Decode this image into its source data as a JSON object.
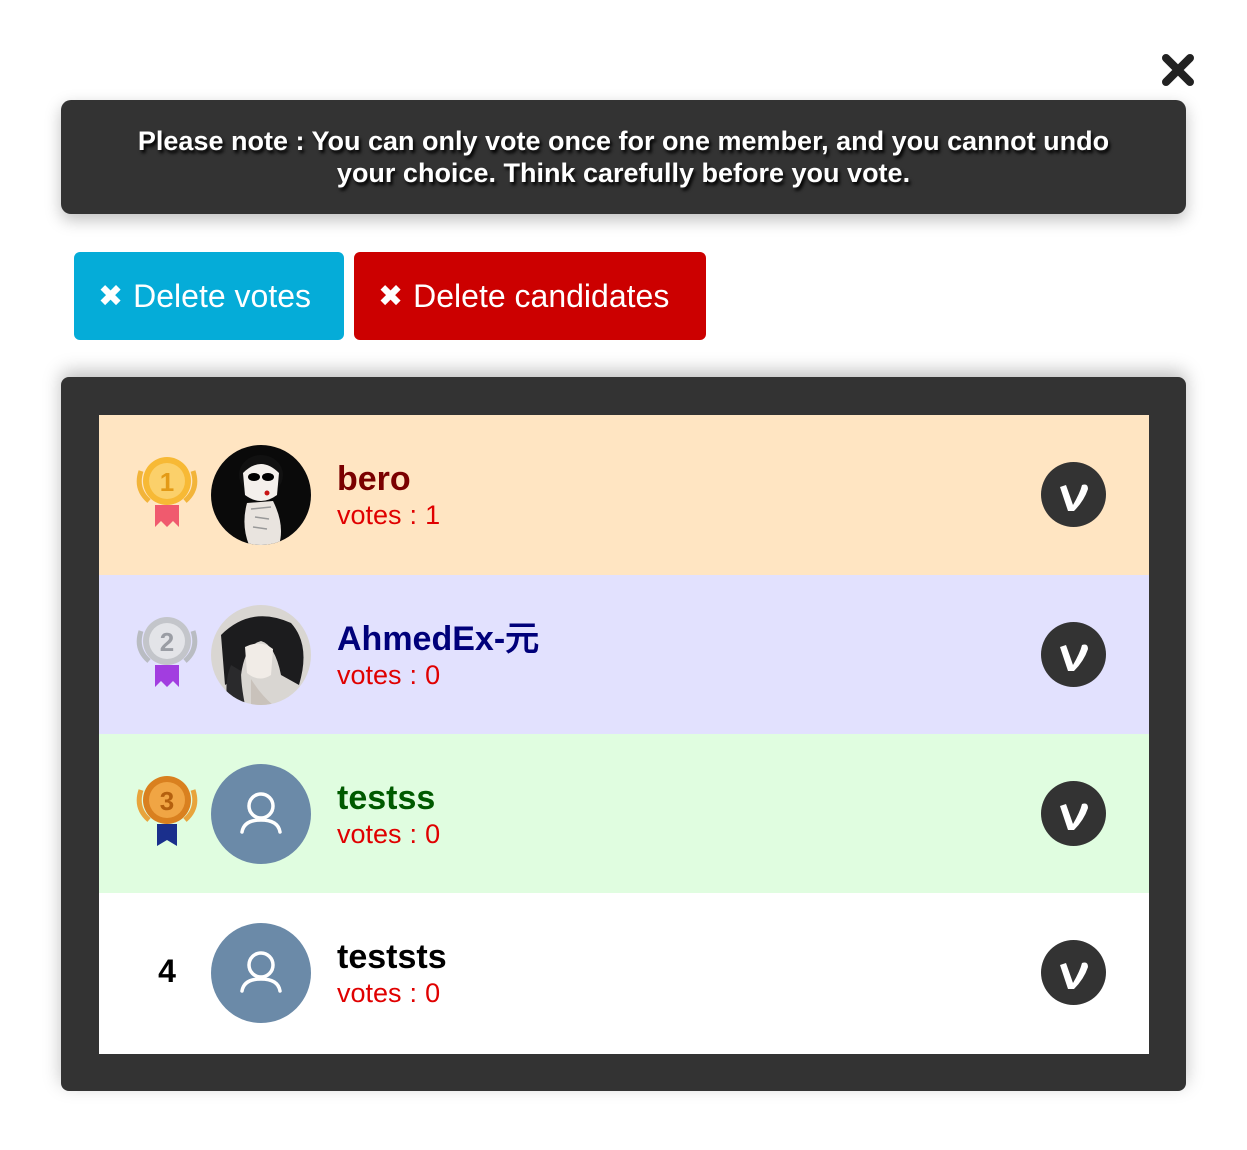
{
  "note": {
    "text": "Please note : You can only vote once for one member, and you cannot undo your choice. Think carefully before you vote."
  },
  "actions": {
    "delete_votes": "Delete votes",
    "delete_candidates": "Delete candidates",
    "icon": "✖"
  },
  "candidates": [
    {
      "rank": "1",
      "name": "bero",
      "votes_label": "votes",
      "votes_sep": ":",
      "votes": "1",
      "name_color": "#7a0000",
      "avatar": "photo-smoker-icon",
      "badge": "gold-medal-icon"
    },
    {
      "rank": "2",
      "name": "AhmedEx-元",
      "votes_label": "votes",
      "votes_sep": ":",
      "votes": "0",
      "name_color": "#00007a",
      "avatar": "photo-longhair-icon",
      "badge": "silver-medal-icon"
    },
    {
      "rank": "3",
      "name": "testss",
      "votes_label": "votes",
      "votes_sep": ":",
      "votes": "0",
      "name_color": "#005a00",
      "avatar": "default-user-icon",
      "badge": "bronze-medal-icon"
    },
    {
      "rank": "4",
      "name": "teststs",
      "votes_label": "votes",
      "votes_sep": ":",
      "votes": "0",
      "name_color": "#000000",
      "avatar": "default-user-icon",
      "badge": "none"
    }
  ],
  "vote_button": {
    "glyph": "v",
    "icon": "vote-v-icon"
  },
  "colors": {
    "dark": "#333333",
    "delete_votes_bg": "#05acd8",
    "delete_candidates_bg": "#cc0000",
    "votes_text": "#e00000",
    "row1_bg": "#ffe5c2",
    "row2_bg": "#e2e1fe",
    "row3_bg": "#e0fde0",
    "row4_bg": "#ffffff",
    "default_avatar_bg": "#6b8aa8"
  }
}
